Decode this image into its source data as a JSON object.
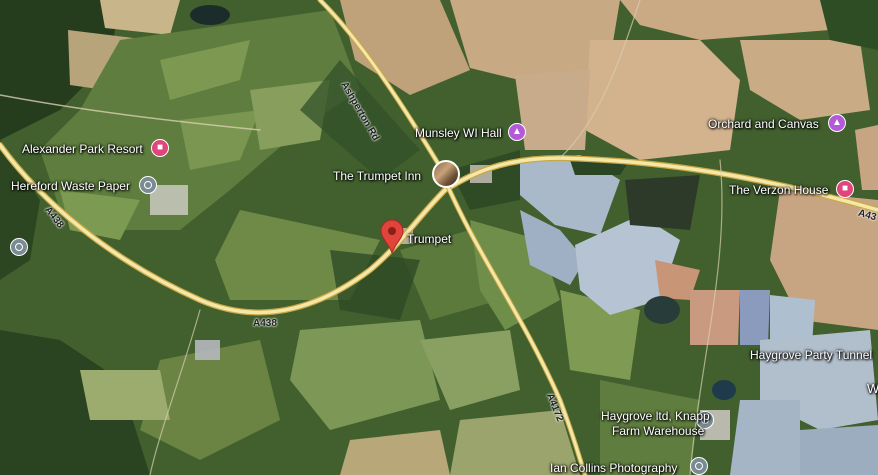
{
  "map": {
    "colors": {
      "road_main": "#f5e7a8",
      "road_edge": "#c9a846",
      "pin": "#e0443a",
      "poi_purple": "#b35ad8",
      "poi_pink": "#e0457b",
      "poi_grey": "#7a8b94"
    },
    "roads": {
      "a438_west": "A438",
      "a438_south": "A438",
      "a438_east": "A43",
      "a4172": "A4172",
      "ashperton_rd": "Ashperton Rd"
    },
    "places": {
      "alexander_park": "Alexander Park Resort",
      "hereford_waste": "Hereford Waste Paper",
      "munsley": "Munsley WI Hall",
      "trumpet_inn": "The Trumpet Inn",
      "trumpet": "Trumpet",
      "orchard": "Orchard and Canvas",
      "verzon": "The Verzon House",
      "haygrove_tunnel": "Haygrove Party Tunnel",
      "haygrove_ltd_1": "Haygrove ltd, Knapp",
      "haygrove_ltd_2": "Farm Warehouse",
      "ian_collins": "Ian Collins Photography",
      "edge_w": "W"
    },
    "icons": {
      "alexander_park": "bed-icon",
      "hereford_waste": "circle-pin-icon",
      "munsley": "landmark-icon",
      "trumpet_inn": "photo-thumbnail-icon",
      "trumpet": "red-map-pin-icon",
      "orchard": "landmark-icon",
      "verzon": "bed-icon",
      "haygrove_ltd": "circle-pin-icon",
      "ian_collins": "circle-pin-icon",
      "edge_west": "bank-icon"
    }
  }
}
